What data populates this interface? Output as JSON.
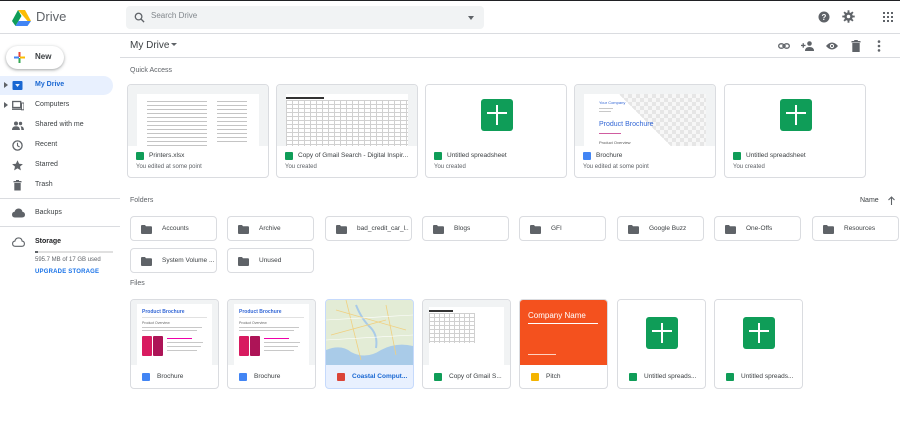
{
  "app": {
    "name": "Drive"
  },
  "search": {
    "placeholder": "Search Drive"
  },
  "sidebar": {
    "new_label": "New",
    "items": [
      {
        "label": "My Drive",
        "icon": "my-drive-icon",
        "active": true
      },
      {
        "label": "Computers",
        "icon": "computers-icon",
        "active": false
      },
      {
        "label": "Shared with me",
        "icon": "shared-icon",
        "active": false
      },
      {
        "label": "Recent",
        "icon": "clock-icon",
        "active": false
      },
      {
        "label": "Starred",
        "icon": "star-icon",
        "active": false
      },
      {
        "label": "Trash",
        "icon": "trash-icon",
        "active": false
      },
      {
        "label": "Backups",
        "icon": "cloud-icon",
        "active": false
      },
      {
        "label": "Storage",
        "icon": "cloud-outline-icon",
        "active": false
      }
    ],
    "storage_used": "595.7 MB of 17 GB used",
    "storage_fraction": 0.035,
    "upgrade_label": "UPGRADE STORAGE"
  },
  "toolbar": {
    "breadcrumb": "My Drive"
  },
  "quick_access": {
    "title": "Quick Access",
    "cards": [
      {
        "name": "Printers.xlsx",
        "sub": "You edited at some point",
        "type": "sheet"
      },
      {
        "name": "Copy of Gmail Search - Digital Inspir...",
        "sub": "You created",
        "type": "sheet"
      },
      {
        "name": "Untitled spreadsheet",
        "sub": "You created",
        "type": "sheet"
      },
      {
        "name": "Brochure",
        "sub": "You edited at some point",
        "type": "doc",
        "preview": {
          "company": "Your Company",
          "title": "Product Brochure",
          "section": "Product Overview"
        }
      },
      {
        "name": "Untitled spreadsheet",
        "sub": "You created",
        "type": "sheet"
      }
    ]
  },
  "folders": {
    "title": "Folders",
    "sort_label": "Name",
    "items": [
      "Accounts",
      "Archive",
      "bad_credit_car_l...",
      "Blogs",
      "GFI",
      "Google Buzz",
      "One-Offs",
      "Resources",
      "System Volume ...",
      "Unused"
    ]
  },
  "files": {
    "title": "Files",
    "items": [
      {
        "name": "Brochure",
        "type": "doc",
        "preview": {
          "title": "Product Brochure",
          "section": "Product Overview"
        }
      },
      {
        "name": "Brochure",
        "type": "doc",
        "preview": {
          "title": "Product Brochure",
          "section": "Product Overview"
        }
      },
      {
        "name": "Coastal Comput...",
        "type": "map",
        "selected": true
      },
      {
        "name": "Copy of Gmail S...",
        "type": "sheet"
      },
      {
        "name": "Pitch",
        "type": "slide",
        "preview": {
          "title": "Company Name"
        }
      },
      {
        "name": "Untitled spreads...",
        "type": "sheet"
      },
      {
        "name": "Untitled spreads...",
        "type": "sheet"
      }
    ]
  },
  "colors": {
    "accent": "#1a73e8",
    "sheet": "#0f9d58",
    "doc": "#4285f4",
    "slide": "#f4b400",
    "pitch": "#f4511e"
  }
}
